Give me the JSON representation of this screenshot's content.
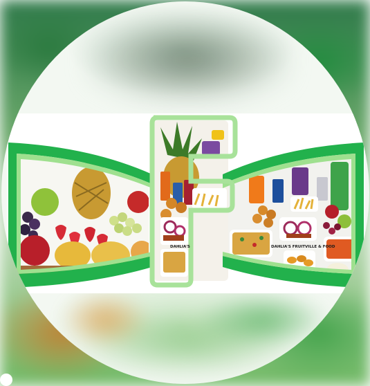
{
  "image": {
    "subject": "Profile logo for a fruit and food vendor",
    "colors": {
      "brand_green": "#1fb44a",
      "light_green": "#a8e29a",
      "banner_bg": "#ffffff"
    },
    "labels": {
      "tray_left": "DAHLIA'S",
      "tray_right": "DAHLIA'S FRUITVILLE & FOOD"
    }
  }
}
